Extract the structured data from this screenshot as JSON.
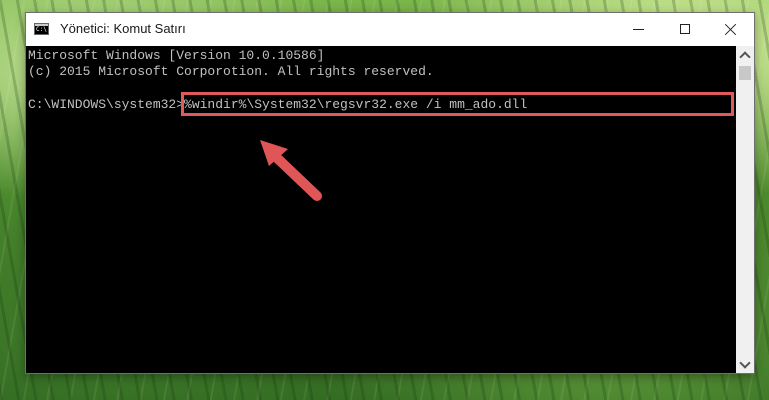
{
  "window": {
    "title": "Yönetici: Komut Satırı",
    "icon": "command-prompt-icon"
  },
  "console": {
    "lines": [
      "Microsoft Windows [Version 10.0.10586]",
      "(c) 2015 Microsoft Corporotion. All rights reserved."
    ],
    "prompt": "C:\\WINDOWS\\system32>",
    "command": "%windir%\\System32\\regsvr32.exe /i mm_ado.dll"
  },
  "colors": {
    "console_background": "#000000",
    "console_text": "#c0c0c0",
    "highlight": "#e05a5a"
  }
}
